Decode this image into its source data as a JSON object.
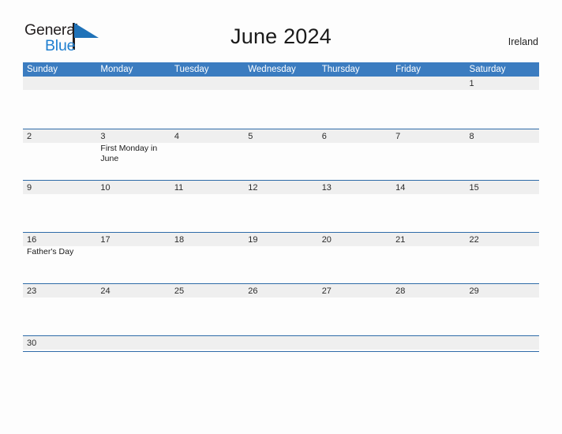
{
  "header": {
    "logo": {
      "word_one": "General",
      "word_two": "Blue",
      "flag_icon": "blue-triangle-flag"
    },
    "title": "June 2024",
    "country": "Ireland"
  },
  "calendar": {
    "day_headers": [
      "Sunday",
      "Monday",
      "Tuesday",
      "Wednesday",
      "Thursday",
      "Friday",
      "Saturday"
    ],
    "accent_color": "#3b7cc0",
    "rule_color": "#2f6ba8",
    "band_color": "#efefef",
    "weeks": [
      {
        "days": [
          {
            "num": "",
            "events": []
          },
          {
            "num": "",
            "events": []
          },
          {
            "num": "",
            "events": []
          },
          {
            "num": "",
            "events": []
          },
          {
            "num": "",
            "events": []
          },
          {
            "num": "",
            "events": []
          },
          {
            "num": "1",
            "events": []
          }
        ]
      },
      {
        "days": [
          {
            "num": "2",
            "events": []
          },
          {
            "num": "3",
            "events": [
              "First Monday in June"
            ]
          },
          {
            "num": "4",
            "events": []
          },
          {
            "num": "5",
            "events": []
          },
          {
            "num": "6",
            "events": []
          },
          {
            "num": "7",
            "events": []
          },
          {
            "num": "8",
            "events": []
          }
        ]
      },
      {
        "days": [
          {
            "num": "9",
            "events": []
          },
          {
            "num": "10",
            "events": []
          },
          {
            "num": "11",
            "events": []
          },
          {
            "num": "12",
            "events": []
          },
          {
            "num": "13",
            "events": []
          },
          {
            "num": "14",
            "events": []
          },
          {
            "num": "15",
            "events": []
          }
        ]
      },
      {
        "days": [
          {
            "num": "16",
            "events": [
              "Father's Day"
            ]
          },
          {
            "num": "17",
            "events": []
          },
          {
            "num": "18",
            "events": []
          },
          {
            "num": "19",
            "events": []
          },
          {
            "num": "20",
            "events": []
          },
          {
            "num": "21",
            "events": []
          },
          {
            "num": "22",
            "events": []
          }
        ]
      },
      {
        "days": [
          {
            "num": "23",
            "events": []
          },
          {
            "num": "24",
            "events": []
          },
          {
            "num": "25",
            "events": []
          },
          {
            "num": "26",
            "events": []
          },
          {
            "num": "27",
            "events": []
          },
          {
            "num": "28",
            "events": []
          },
          {
            "num": "29",
            "events": []
          }
        ]
      },
      {
        "days": [
          {
            "num": "30",
            "events": []
          },
          {
            "num": "",
            "events": []
          },
          {
            "num": "",
            "events": []
          },
          {
            "num": "",
            "events": []
          },
          {
            "num": "",
            "events": []
          },
          {
            "num": "",
            "events": []
          },
          {
            "num": "",
            "events": []
          }
        ]
      }
    ]
  }
}
